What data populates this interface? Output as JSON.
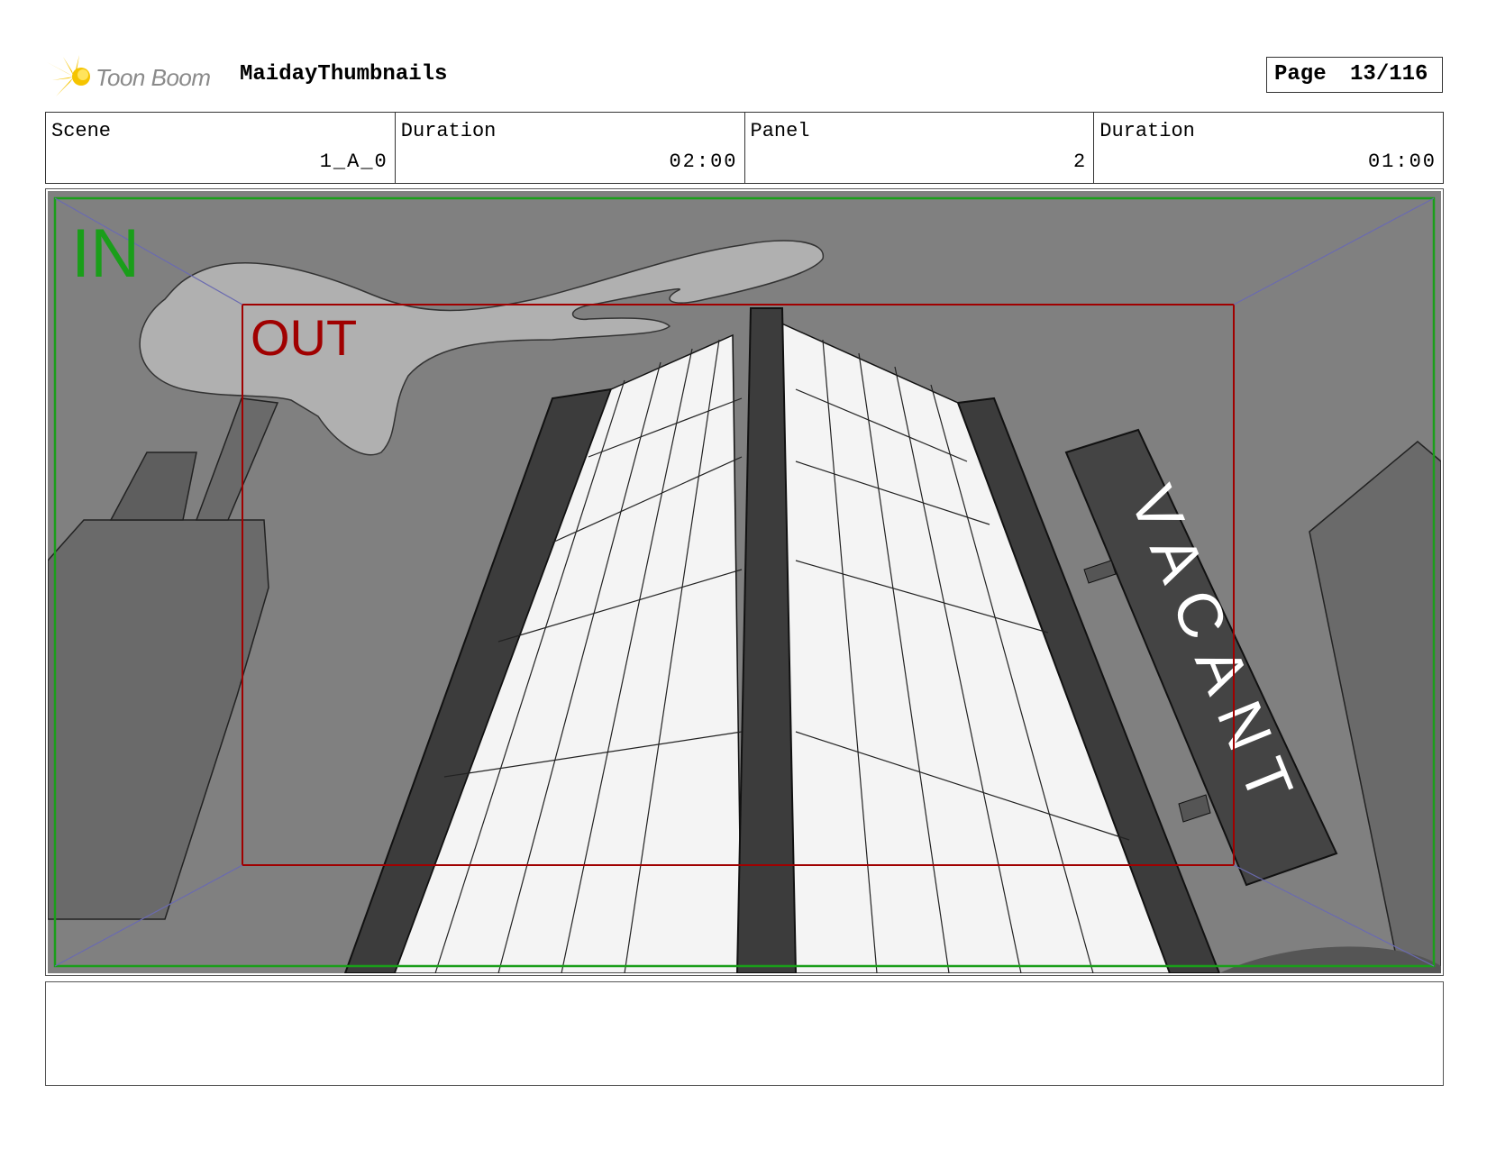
{
  "header": {
    "logo_text": "Toon Boom",
    "project_title": "MaidayThumbnails",
    "page_label": "Page",
    "page_number": "13/116"
  },
  "info": {
    "scene_label": "Scene",
    "scene_value": "1_A_0",
    "scene_duration_label": "Duration",
    "scene_duration_value": "02:00",
    "panel_label": "Panel",
    "panel_value": "2",
    "panel_duration_label": "Duration",
    "panel_duration_value": "01:00"
  },
  "panel": {
    "in_label": "IN",
    "out_label": "OUT",
    "sign_text": "VACANT",
    "colors": {
      "in_field": "#1a9e1a",
      "out_field": "#a00000",
      "camera_path": "#6a6ab0",
      "sky": "#808080"
    }
  },
  "notes": {
    "text": ""
  }
}
